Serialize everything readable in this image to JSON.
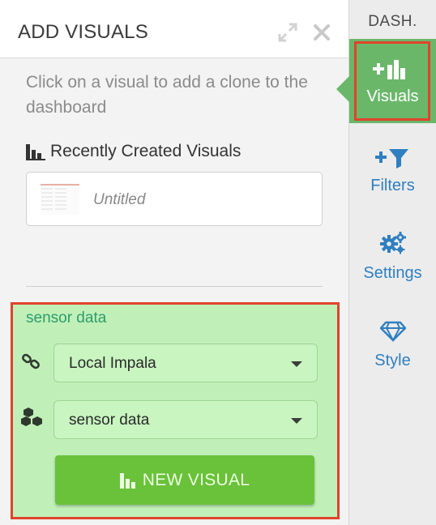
{
  "panel": {
    "title": "ADD VISUALS",
    "expand_icon": "expand-icon",
    "close_icon": "close-icon",
    "instruction": "Click on a visual to add a clone to the dashboard",
    "recent_title": "Recently Created Visuals",
    "recent_visuals": [
      {
        "label": "Untitled"
      }
    ]
  },
  "data_source": {
    "label": "sensor data",
    "connection": "Local Impala",
    "dataset": "sensor data",
    "new_visual_label": "NEW VISUAL"
  },
  "sidebar": {
    "header": "DASH.",
    "items": [
      {
        "label": "Visuals",
        "icon": "add-chart-icon",
        "active": true
      },
      {
        "label": "Filters",
        "icon": "add-filter-icon"
      },
      {
        "label": "Settings",
        "icon": "gears-icon"
      },
      {
        "label": "Style",
        "icon": "diamond-icon"
      }
    ]
  },
  "colors": {
    "accent_green": "#6ab76a",
    "button_green": "#6ac13a",
    "highlight_red": "#e0432b",
    "link_blue": "#2f7fc1"
  }
}
